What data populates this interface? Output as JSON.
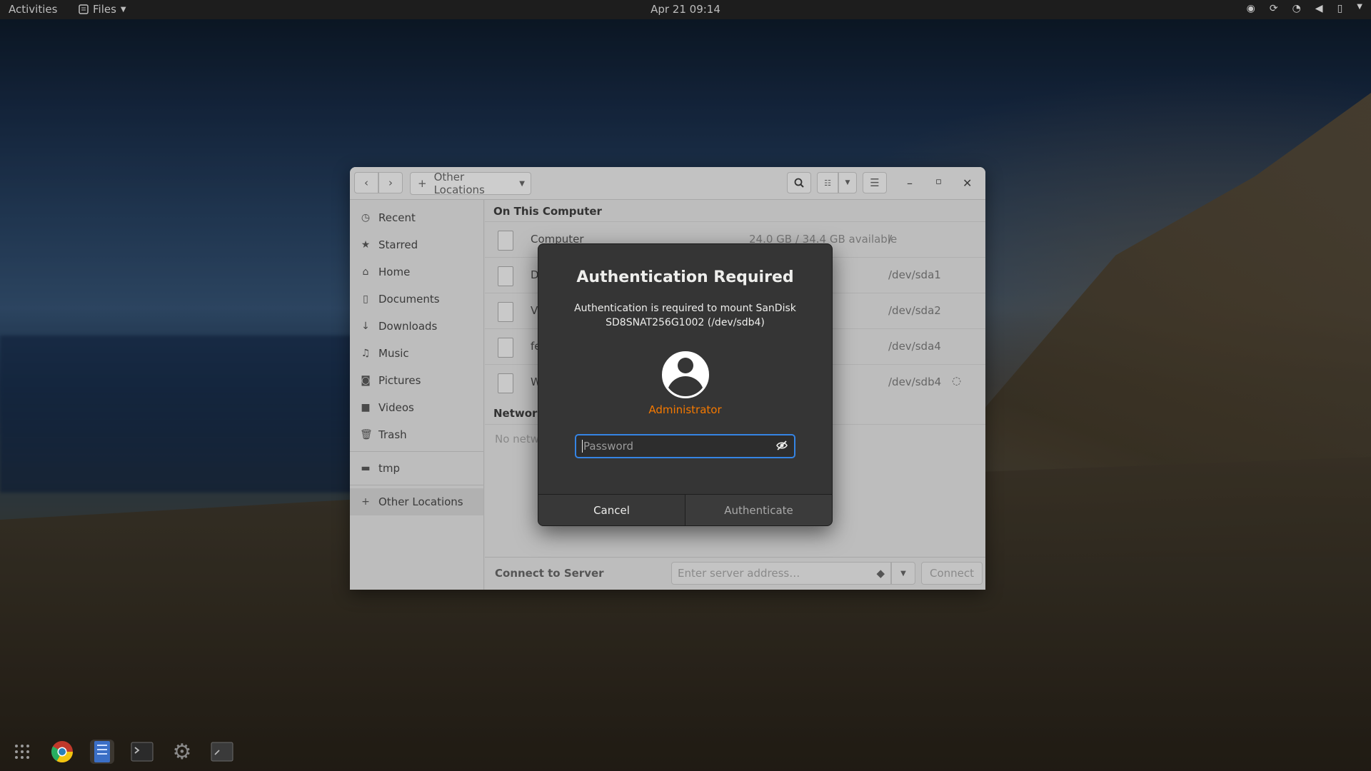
{
  "topbar": {
    "activities": "Activities",
    "app_menu": "Files",
    "clock": "Apr 21  09:14",
    "tray_icons": [
      "chrome-icon",
      "refresh-icon",
      "wifi-icon",
      "volume-icon",
      "battery-icon",
      "chevron-down-icon"
    ]
  },
  "window": {
    "path_label": "Other Locations",
    "sidebar": {
      "items": [
        {
          "label": "Recent",
          "icon": "clock-icon"
        },
        {
          "label": "Starred",
          "icon": "star-icon"
        },
        {
          "label": "Home",
          "icon": "home-icon"
        },
        {
          "label": "Documents",
          "icon": "document-icon"
        },
        {
          "label": "Downloads",
          "icon": "download-icon"
        },
        {
          "label": "Music",
          "icon": "music-icon"
        },
        {
          "label": "Pictures",
          "icon": "camera-icon"
        },
        {
          "label": "Videos",
          "icon": "video-icon"
        },
        {
          "label": "Trash",
          "icon": "trash-icon"
        }
      ],
      "bookmarks": [
        {
          "label": "tmp",
          "icon": "folder-icon"
        }
      ],
      "other_locations": "Other Locations"
    },
    "on_this_computer": "On This Computer",
    "rows": [
      {
        "name": "Computer",
        "size": "24.0 GB / 34.4 GB available",
        "dev": "/"
      },
      {
        "name": "D",
        "size": "",
        "dev": "/dev/sda1"
      },
      {
        "name": "V",
        "size": "",
        "dev": "/dev/sda2"
      },
      {
        "name": "fe",
        "size": "",
        "dev": "/dev/sda4"
      },
      {
        "name": "W",
        "size": "",
        "dev": "/dev/sdb4"
      }
    ],
    "networks_title": "Networks",
    "networks_empty": "No netwo",
    "connect": {
      "label": "Connect to Server",
      "placeholder": "Enter server address…",
      "button": "Connect"
    }
  },
  "dialog": {
    "title": "Authentication Required",
    "message_line1": "Authentication is required to mount SanDisk",
    "message_line2": "SD8SNAT256G1002 (/dev/sdb4)",
    "user": "Administrator",
    "password_placeholder": "Password",
    "cancel": "Cancel",
    "authenticate": "Authenticate"
  }
}
